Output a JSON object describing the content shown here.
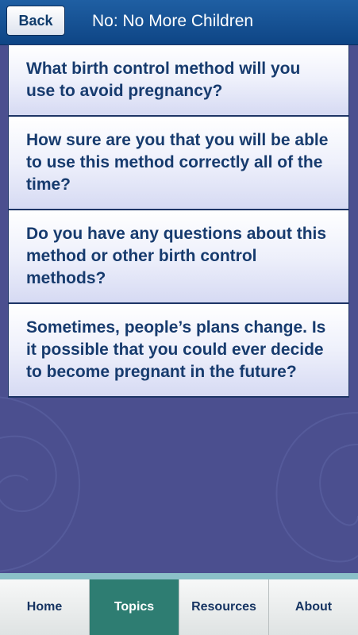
{
  "header": {
    "back_label": "Back",
    "title": "No: No More Children"
  },
  "questions": [
    "What birth control method will you use to avoid pregnancy?",
    "How sure are you that you will be able to use this method correctly all of the time?",
    "Do you have any questions about this method or other birth control methods?",
    "Sometimes, people’s plans change. Is it possible that you could ever decide to become pregnant in the future?"
  ],
  "tabs": [
    {
      "label": "Home",
      "active": false
    },
    {
      "label": "Topics",
      "active": true
    },
    {
      "label": "Resources",
      "active": false
    },
    {
      "label": "About",
      "active": false
    }
  ],
  "colors": {
    "background": "#4b4f8f",
    "header": "#0e4585",
    "question_text": "#173b6e",
    "active_tab": "#2e7d72",
    "tabbar_accent": "#8bc0c8"
  }
}
